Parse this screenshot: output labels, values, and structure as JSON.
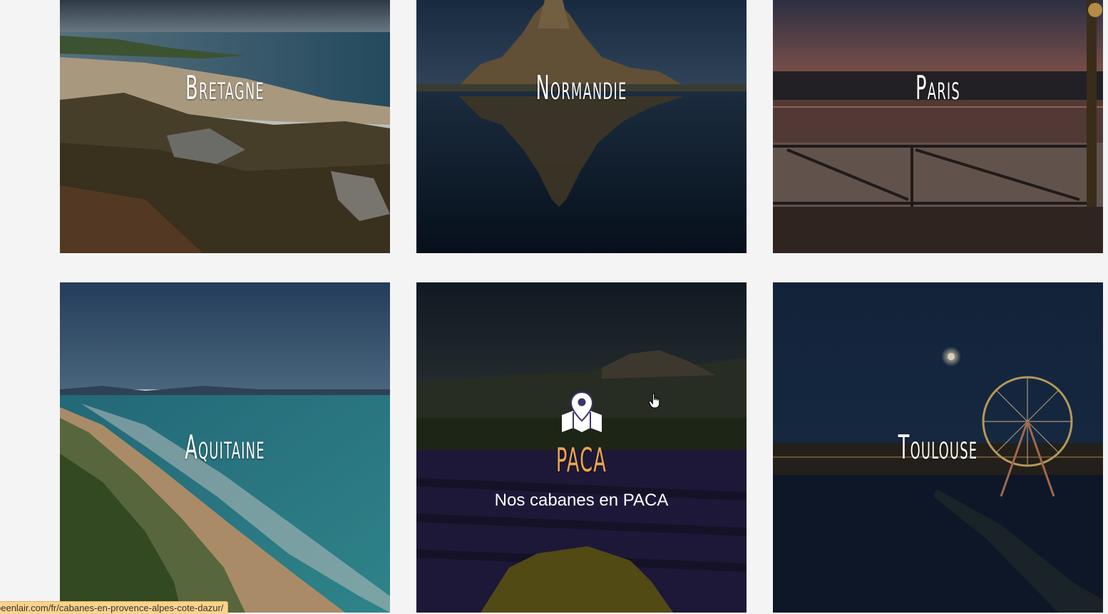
{
  "tiles": [
    {
      "name": "Bretagne",
      "label": "Bretagne"
    },
    {
      "name": "Normandie",
      "label": "Normandie"
    },
    {
      "name": "Paris",
      "label": "Paris"
    },
    {
      "name": "Aquitaine",
      "label": "Aquitaine"
    },
    {
      "name": "PACA",
      "label": "PACA",
      "subtitle": "Nos cabanes en PACA",
      "hovered": true
    },
    {
      "name": "Toulouse",
      "label": "Toulouse"
    }
  ],
  "status_bar": {
    "url": "peenlair.com/fr/cabanes-en-provence-alpes-cote-dazur/"
  },
  "colors": {
    "accent": "#e9a64d",
    "background": "#f4f4f4"
  },
  "icons": {
    "hover_icon": "map-marker-icon",
    "cursor": "hand-pointer-icon"
  }
}
